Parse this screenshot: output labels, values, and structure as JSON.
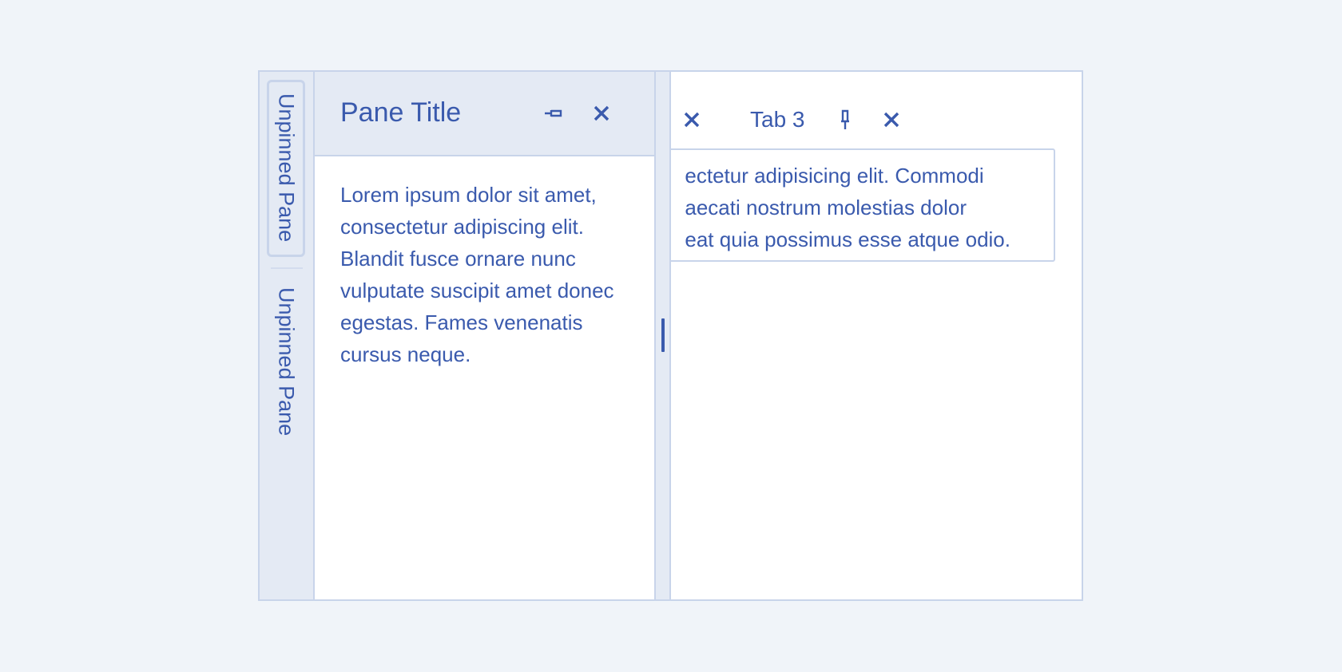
{
  "sidebar": {
    "tabs": [
      {
        "label": "Unpinned Pane",
        "active": true
      },
      {
        "label": "Unpinned Pane",
        "active": false
      }
    ]
  },
  "pane": {
    "title": "Pane Title",
    "pin_icon": "pin-icon",
    "close_icon": "close-icon",
    "body": "Lorem ipsum dolor sit amet, consectetur adipiscing elit. Blandit fusce ornare nunc vulputate suscipit amet donec egestas. Fames venenatis cursus neque."
  },
  "document": {
    "tabs": [
      {
        "label": "",
        "close_icon": "close-icon"
      },
      {
        "label": "Tab 3",
        "pin_icon": "pin-icon",
        "close_icon": "close-icon"
      }
    ],
    "content_lines": [
      "ectetur adipisicing elit. Commodi",
      "aecati nostrum molestias dolor",
      "eat quia possimus esse atque odio."
    ]
  },
  "colors": {
    "background": "#f0f4f9",
    "accent": "#3a5aad",
    "panel": "#e4eaf4",
    "border": "#c8d4ea"
  }
}
